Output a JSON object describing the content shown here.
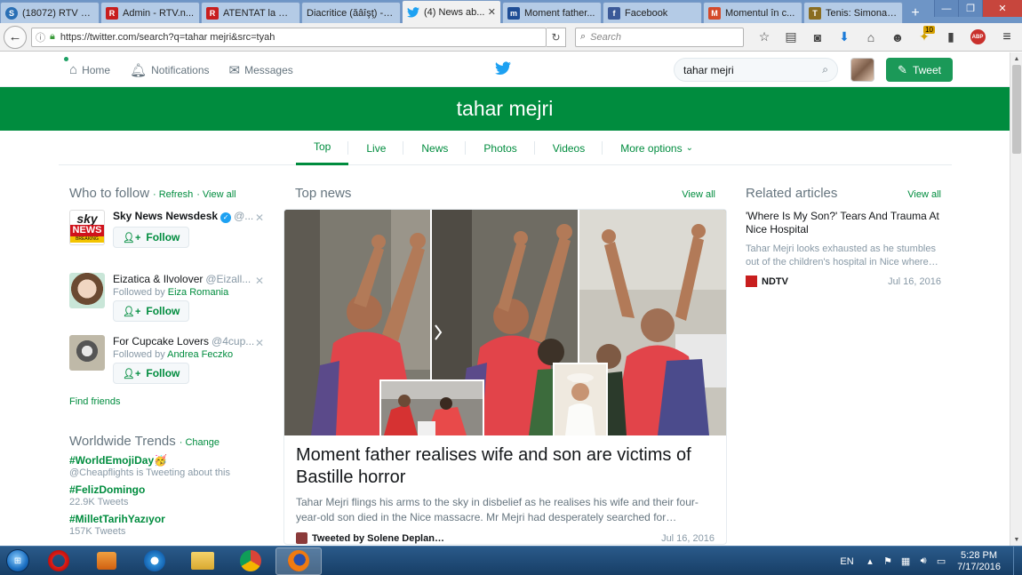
{
  "browser": {
    "tabs": [
      {
        "label": "(18072) RTV W...",
        "icon": "skype-icon",
        "color": "#2a6fb5"
      },
      {
        "label": "Admin - RTV.n...",
        "icon": "rtv-icon",
        "color": "#c81e1e"
      },
      {
        "label": "ATENTAT la NI...",
        "icon": "rtv-icon",
        "color": "#c81e1e"
      },
      {
        "label": "Diacritice (ăâîşţ) - t...",
        "icon": "blank-page-icon",
        "color": "#6e95c6"
      },
      {
        "label": "(4) News ab...",
        "icon": "twitter-icon",
        "color": "#1da1f2",
        "active": true
      },
      {
        "label": "Moment father...",
        "icon": "mailonline-icon",
        "color": "#1f4e96"
      },
      {
        "label": "Facebook",
        "icon": "facebook-icon",
        "color": "#3b5998"
      },
      {
        "label": "Momentul în c...",
        "icon": "news-icon",
        "color": "#d44a2a"
      },
      {
        "label": "Tenis: Simona ...",
        "icon": "tennis-icon",
        "color": "#8a6d20"
      }
    ],
    "new_tab": "+",
    "url": "https://twitter.com/search?q=tahar mejri&src=tyah",
    "search_placeholder": "Search",
    "addon_badge": "10",
    "abp_label": "ABP"
  },
  "twitter": {
    "nav": {
      "home": "Home",
      "notifications": "Notifications",
      "messages": "Messages"
    },
    "search_query": "tahar mejri",
    "tweet_button": "Tweet",
    "banner_title": "tahar mejri",
    "tabs": [
      "Top",
      "Live",
      "News",
      "Photos",
      "Videos"
    ],
    "more_options": "More options",
    "selected_tab": "Top",
    "brand_color": "#008c3e",
    "who_to_follow": {
      "title": "Who to follow",
      "refresh": "Refresh",
      "view_all": "View all",
      "follow_label": "Follow",
      "followed_by_prefix": "Followed by",
      "accounts": [
        {
          "name": "Sky News Newsdesk",
          "handle": "@...",
          "verified": true,
          "followed_by": ""
        },
        {
          "name": "Eizatica & Ilvolover",
          "handle": "@Eizall...",
          "verified": false,
          "followed_by": "Eiza Romania"
        },
        {
          "name": "For Cupcake Lovers",
          "handle": "@4cup...",
          "verified": false,
          "followed_by": "Andrea Feczko"
        }
      ],
      "find_friends": "Find friends",
      "sky_logo_top": "sky",
      "sky_logo_mid": "NEWS",
      "sky_logo_bottom": "BREAKING"
    },
    "trends": {
      "title": "Worldwide Trends",
      "change": "Change",
      "items": [
        {
          "tag": "#WorldEmojiDay🥳",
          "meta": "@Cheapflights is Tweeting about this"
        },
        {
          "tag": "#FelizDomingo",
          "meta": "22.9K Tweets"
        },
        {
          "tag": "#MilletTarihYazıyor",
          "meta": "157K Tweets"
        }
      ]
    },
    "top_news": {
      "title": "Top news",
      "view_all": "View all",
      "card": {
        "headline": "Moment father realises wife and son are victims of Bastille horror",
        "description": "Tahar Mejri flings his arms to the sky in disbelief as he realises his wife and their four-year-old son died in the Nice massacre. Mr Mejri had desperately searched for…",
        "tweeted_by": "Tweeted by Solene Deplan…",
        "date": "Jul 16, 2016"
      }
    },
    "related": {
      "title": "Related articles",
      "view_all": "View all",
      "articles": [
        {
          "title": "'Where Is My Son?' Tears And Trauma At Nice Hospital",
          "description": "Tahar Mejri looks exhausted as he stumbles out of the children's hospital in Nice where…",
          "source": "NDTV",
          "date": "Jul 16, 2016"
        }
      ]
    }
  },
  "taskbar": {
    "apps": [
      "opera-icon",
      "media-player-icon",
      "internet-explorer-icon",
      "file-explorer-icon",
      "chrome-icon",
      "firefox-icon"
    ],
    "active_app": "firefox-icon",
    "language": "EN",
    "time": "5:28 PM",
    "date": "7/17/2016"
  }
}
